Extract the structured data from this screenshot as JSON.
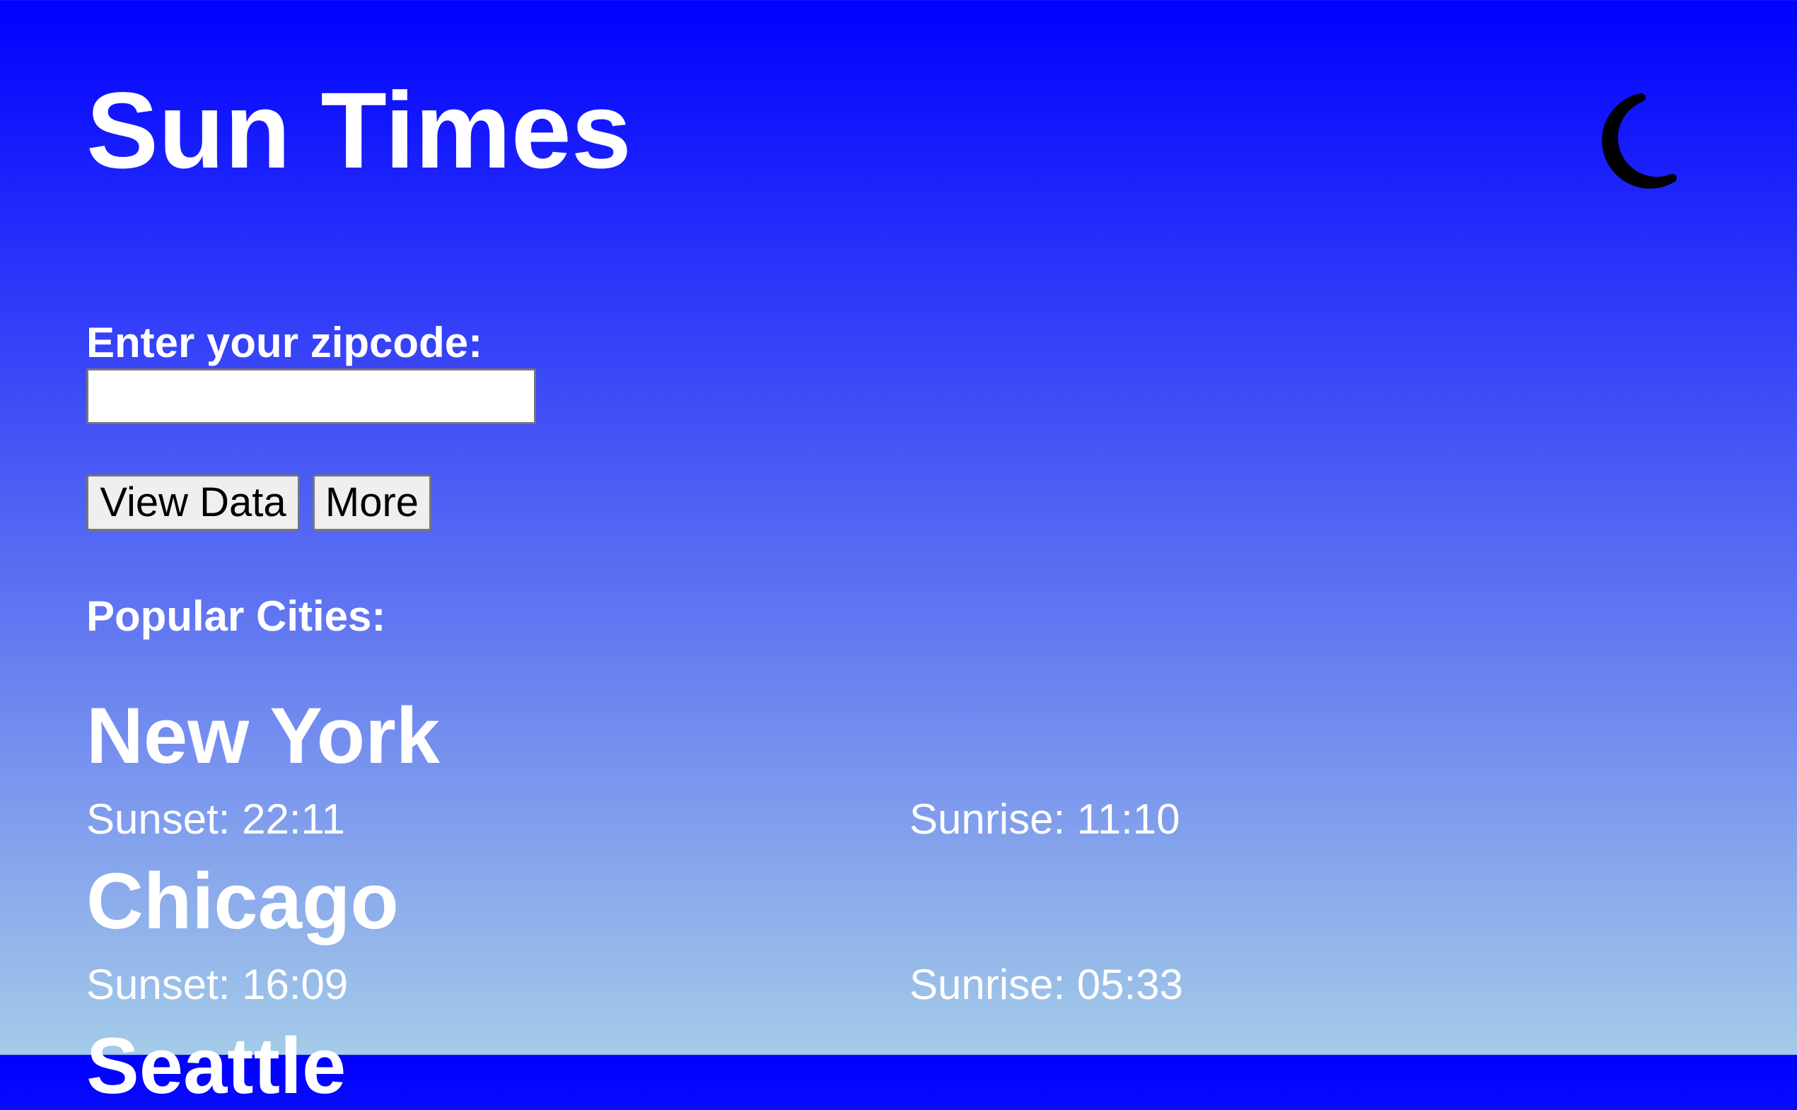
{
  "header": {
    "title": "Sun Times",
    "theme_icon": "moon-icon"
  },
  "form": {
    "zip_label": "Enter your zipcode:",
    "zip_value": "",
    "zip_placeholder": "",
    "view_button": "View Data",
    "more_button": "More"
  },
  "popular": {
    "label": "Popular Cities:",
    "cities": [
      {
        "name": "New York",
        "sunset": "Sunset: 22:11",
        "sunrise": "Sunrise: 11:10"
      },
      {
        "name": "Chicago",
        "sunset": "Sunset: 16:09",
        "sunrise": "Sunrise: 05:33"
      },
      {
        "name": "Seattle"
      }
    ]
  },
  "colors": {
    "gradient_top": "#0000ff",
    "gradient_bottom": "#a4cbe8",
    "text": "#ffffff",
    "icon": "#000000"
  }
}
